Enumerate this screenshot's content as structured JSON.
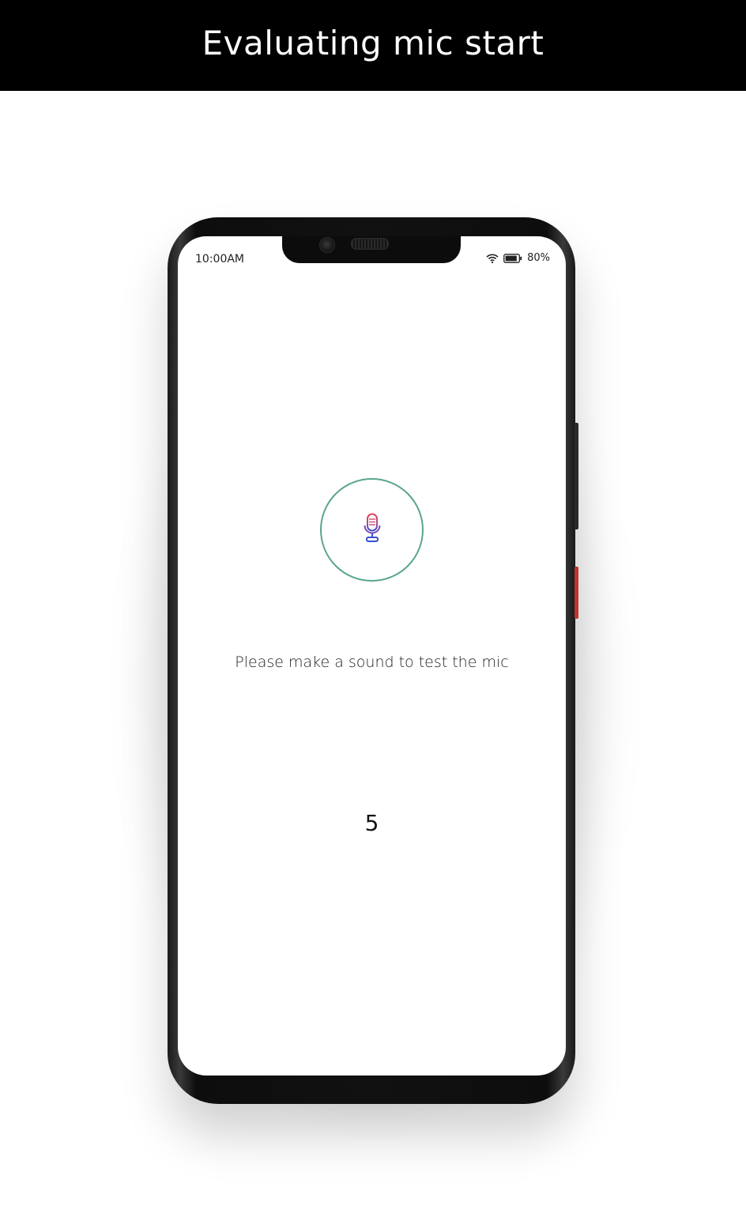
{
  "banner": {
    "title": "Evaluating mic start"
  },
  "status_bar": {
    "time": "10:00AM",
    "battery_percent": "80%",
    "icons": [
      "wifi-icon",
      "battery-icon"
    ]
  },
  "main": {
    "mic_icon": "microphone-icon",
    "prompt": "Please make a sound to test the mic",
    "countdown": "5"
  },
  "colors": {
    "ring": "#5aa58f",
    "mic_top": "#e0475a",
    "mic_bottom": "#3a4fd0",
    "banner_bg": "#000000",
    "banner_text": "#ffffff"
  }
}
